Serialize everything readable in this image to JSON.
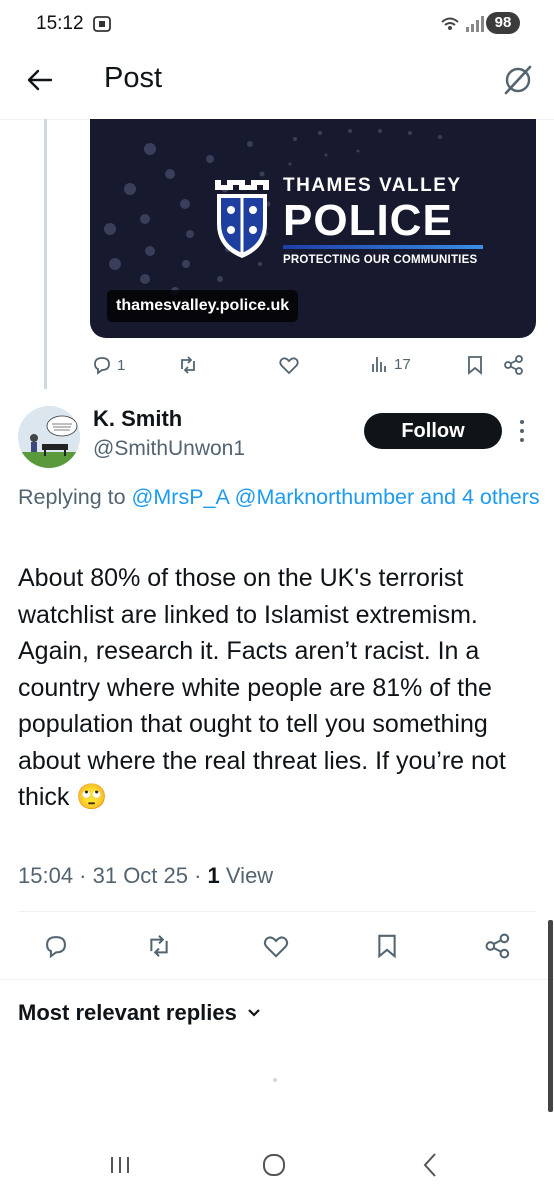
{
  "status_bar": {
    "time": "15:12",
    "battery": "98"
  },
  "header": {
    "title": "Post",
    "back_icon": "arrow-left-icon",
    "grok_icon": "grok-icon"
  },
  "quoted_card": {
    "brand_top": "THAMES VALLEY",
    "brand_main": "POLICE",
    "tagline": "PROTECTING OUR COMMUNITIES",
    "domain": "thamesvalley.police.uk",
    "colors": {
      "background": "#171a2e",
      "accent": "#3a8ee6"
    }
  },
  "quoted_actions": {
    "replies": "1",
    "views": "17"
  },
  "reply": {
    "author_name": "K. Smith",
    "author_handle": "@SmithUnwon1",
    "follow_label": "Follow",
    "replying_prefix": "Replying to ",
    "replying_users": "@MrsP_A @Marknorthumber and 4 others",
    "body": "About 80% of those on the UK's terrorist watchlist are linked to Islamist extremism. Again, research it. Facts aren’t racist. In a country where white people are 81% of the population that ought to tell you something about where the real threat lies. If you’re not thick 🙄",
    "timestamp": "15:04 · 31 Oct 25 · ",
    "view_count": "1",
    "view_label": " View"
  },
  "replies_sort": {
    "label": "Most relevant replies"
  },
  "colors": {
    "link": "#1d9bf0",
    "muted": "#536471",
    "text": "#0f1419"
  }
}
